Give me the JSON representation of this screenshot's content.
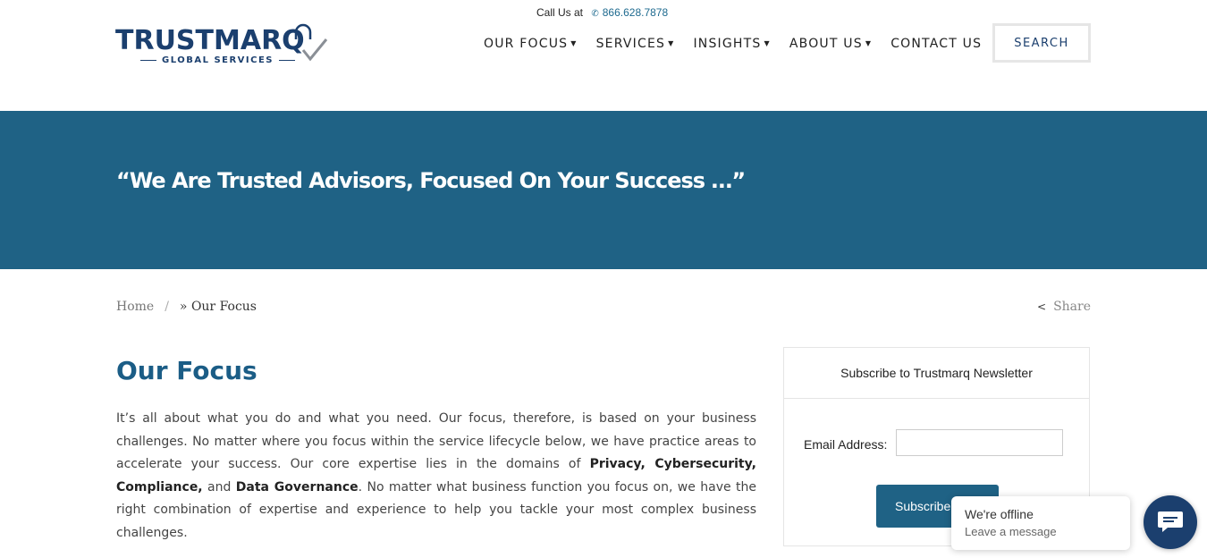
{
  "header": {
    "call_label": "Call Us at",
    "phone": "866.628.7878",
    "logo_main": "TRUSTMARQ",
    "logo_sub": "GLOBAL SERVICES",
    "nav": [
      {
        "label": "OUR FOCUS",
        "dropdown": true
      },
      {
        "label": "SERVICES",
        "dropdown": true
      },
      {
        "label": "INSIGHTS",
        "dropdown": true
      },
      {
        "label": "ABOUT US",
        "dropdown": true
      },
      {
        "label": "CONTACT US",
        "dropdown": false
      }
    ],
    "search_label": "SEARCH"
  },
  "hero": {
    "title": "“We Are Trusted Advisors, Focused On Your Success …”"
  },
  "breadcrumb": {
    "home": "Home",
    "separator": "/",
    "current": "» Our Focus"
  },
  "share_label": "Share",
  "main": {
    "title": "Our Focus",
    "para_part1": "It’s all about what you do and what you need. Our focus, therefore, is based on your business challenges. No matter where you focus within the service lifecycle below, we have practice areas to accelerate your success. Our core expertise lies in the domains of ",
    "bold1": "Privacy, Cybersecurity, Compliance,",
    "para_part2": " and ",
    "bold2": "Data Governance",
    "para_part3": ". No matter what business function you focus on, we have the right combination of expertise and experience to help you tackle your most complex business challenges."
  },
  "newsletter": {
    "title": "Subscribe to Trustmarq Newsletter",
    "email_label": "Email Address:",
    "email_value": "",
    "button_label": "Subscribe"
  },
  "chat": {
    "status": "We're offline",
    "sub": "Leave a message"
  },
  "colors": {
    "brand_dark": "#1b3f6e",
    "hero_bg": "#1f6285",
    "title_blue": "#1b5d86"
  }
}
